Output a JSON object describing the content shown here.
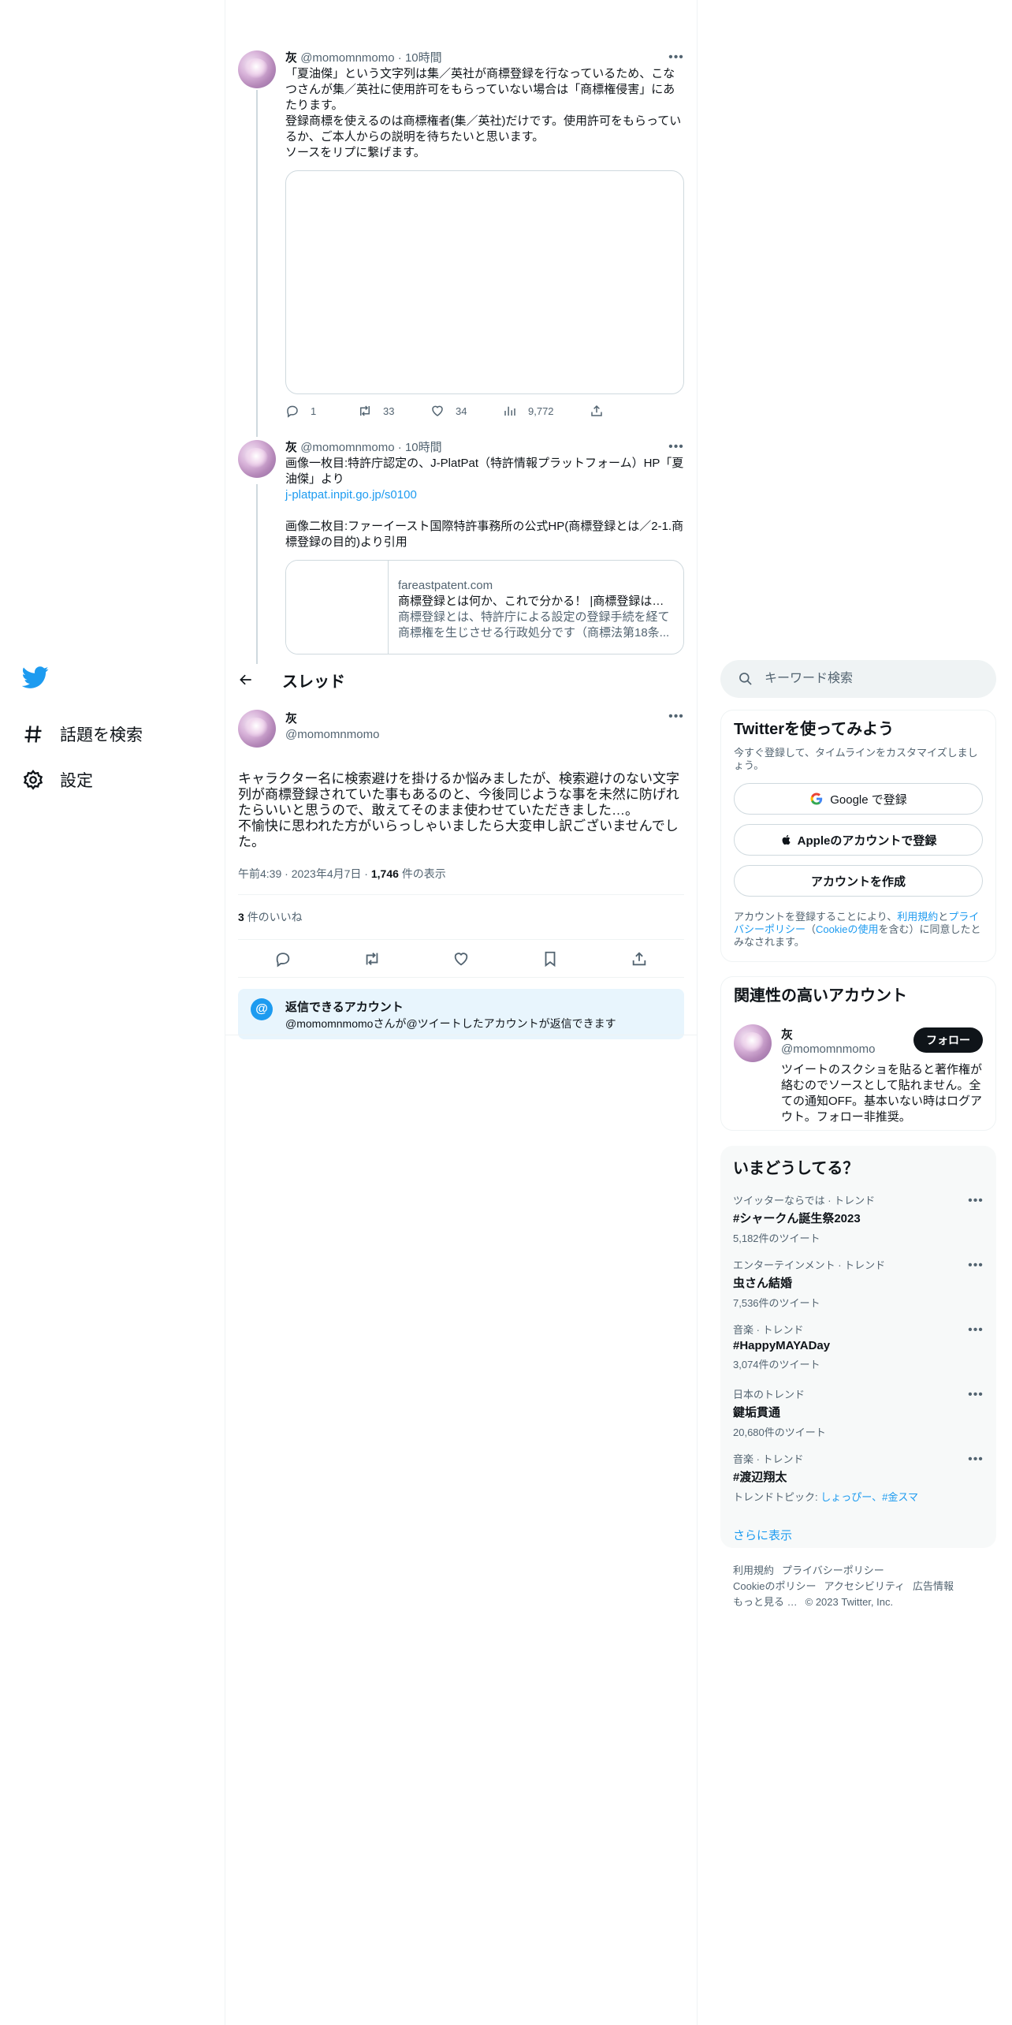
{
  "nav": {
    "items": [
      {
        "label": "話題を検索"
      },
      {
        "label": "設定"
      }
    ]
  },
  "thread_tweets": [
    {
      "name": "灰",
      "handle": "@momomnmomo",
      "time": "10時間",
      "text": "「夏油傑」という文字列は集／英社が商標登録を行なっているため、こなつさんが集／英社に使用許可をもらっていない場合は「商標権侵害」にあたります。\n登録商標を使えるのは商標権者(集／英社)だけです。使用許可をもらっているか、ご本人からの説明を待ちたいと思います。\nソースをリプに繋げます。",
      "stats": {
        "replies": "1",
        "retweets": "33",
        "likes": "34",
        "views": "9,772"
      }
    },
    {
      "name": "灰",
      "handle": "@momomnmomo",
      "time": "10時間",
      "text_1": "画像一枚目:特許庁認定の、J-PlatPat（特許情報プラットフォーム）HP「夏油傑」より",
      "link": "j-platpat.inpit.go.jp/s0100",
      "text_2": "画像二枚目:ファーイースト国際特許事務所の公式HP(商標登録とは／2-1.商標登録の目的)より引用",
      "card": {
        "domain": "fareastpatent.com",
        "title": "商標登録とは何か、これで分かる！ |商標登録はフ...",
        "desc": "商標登録とは、特許庁による設定の登録手続を経て商標権を生じさせる行政処分です（商標法第18条..."
      }
    }
  ],
  "header": {
    "title": "スレッド"
  },
  "focus_tweet": {
    "name": "灰",
    "handle": "@momomnmomo",
    "text": "キャラクター名に検索避けを掛けるか悩みましたが、検索避けのない文字列が商標登録されていた事もあるのと、今後同じような事を未然に防げれたらいいと思うので、敢えてそのまま使わせていただきました…。\n不愉快に思われた方がいらっしゃいましたら大変申し訳ございませんでした。",
    "time": "午前4:39",
    "date": "2023年4月7日",
    "views_count": "1,746",
    "views_label": "件の表示",
    "likes_count": "3",
    "likes_label": "件のいいね",
    "reply_title": "返信できるアカウント",
    "reply_sub": "@momomnmomoさんが@ツイートしたアカウントが返信できます"
  },
  "search": {
    "placeholder": "キーワード検索"
  },
  "signup": {
    "title": "Twitterを使ってみよう",
    "sub": "今すぐ登録して、タイムラインをカスタマイズしましょう。",
    "google": "Google で登録",
    "apple": "Appleのアカウントで登録",
    "create": "アカウントを作成",
    "legal_1": "アカウントを登録することにより、",
    "legal_terms": "利用規約",
    "legal_2": "と",
    "legal_privacy": "プライバシーポリシー",
    "legal_3": "（",
    "legal_cookie": "Cookieの使用",
    "legal_4": "を含む）に同意したとみなされます。"
  },
  "related": {
    "title": "関連性の高いアカウント",
    "name": "灰",
    "handle": "@momomnmomo",
    "follow": "フォロー",
    "bio": "ツイートのスクショを貼ると著作権が絡むのでソースとして貼れません。全ての通知OFF。基本いない時はログアウト。フォロー非推奨。"
  },
  "trends": {
    "title": "いまどうしてる？",
    "items": [
      {
        "cat": "ツイッターならでは · トレンド",
        "title": "#シャークん誕生祭2023",
        "count": "5,182件のツイート"
      },
      {
        "cat": "エンターテインメント · トレンド",
        "title": "虫さん結婚",
        "count": "7,536件のツイート"
      },
      {
        "cat": "音楽 · トレンド",
        "title": "#HappyMAYADay",
        "count": "3,074件のツイート"
      },
      {
        "cat": "日本のトレンド",
        "title": "鍵垢貫通",
        "count": "20,680件のツイート"
      },
      {
        "cat": "音楽 · トレンド",
        "title": "#渡辺翔太",
        "topic_label": "トレンドトピック: ",
        "topic_links": "しょっぴー、#金スマ"
      }
    ],
    "show_more": "さらに表示"
  },
  "footer": {
    "line1": [
      "利用規約",
      "プライバシーポリシー"
    ],
    "line2": [
      "Cookieのポリシー",
      "アクセシビリティ",
      "広告情報"
    ],
    "more": "もっと見る …",
    "copyright": "© 2023 Twitter, Inc."
  },
  "colors": {
    "accent": "#1d9bf0",
    "text": "#0f1419",
    "muted": "#536471",
    "border": "#eff3f4"
  }
}
